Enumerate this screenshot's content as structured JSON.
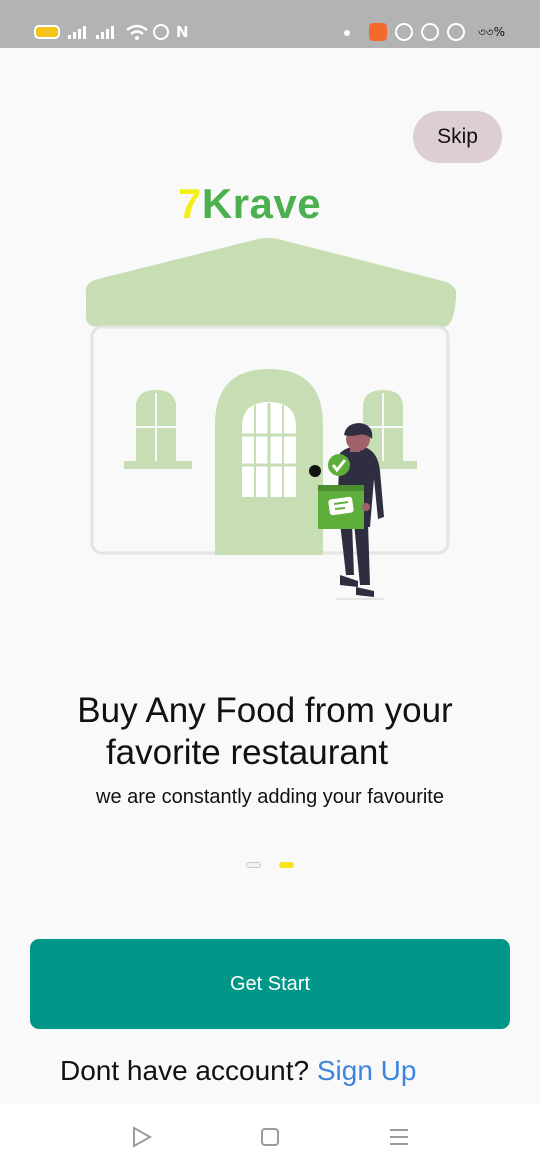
{
  "status_bar": {
    "battery_text": "৩৩%",
    "icons": [
      "battery-icon",
      "signal-icon",
      "signal-icon",
      "wifi-icon",
      "alarm-icon",
      "nfc-icon",
      "notification-dot-icon",
      "app-icon",
      "facebook-icon",
      "messenger-icon",
      "mountain-app-icon"
    ],
    "battery_color": "#f7c31a"
  },
  "skip_label": "Skip",
  "logo": {
    "part1": "7",
    "part2": "Krave",
    "color1": "#f3ef1f",
    "color2": "#4caf50"
  },
  "headline": {
    "line1": "Buy Any Food from your",
    "line2": "favorite restaurant"
  },
  "subtitle": "we are constantly adding your favourite",
  "pagination": {
    "count": 2,
    "active_index": 1
  },
  "cta_label": "Get Start",
  "account": {
    "prompt": "Dont have account?",
    "link": "Sign Up"
  },
  "nav_bar": {
    "icons": [
      "back-triangle-icon",
      "home-square-icon",
      "menu-icon"
    ]
  },
  "colors": {
    "primary": "#009688",
    "accent": "#f7e51c",
    "link": "#3d86e0",
    "skip_bg": "#dcced4"
  }
}
